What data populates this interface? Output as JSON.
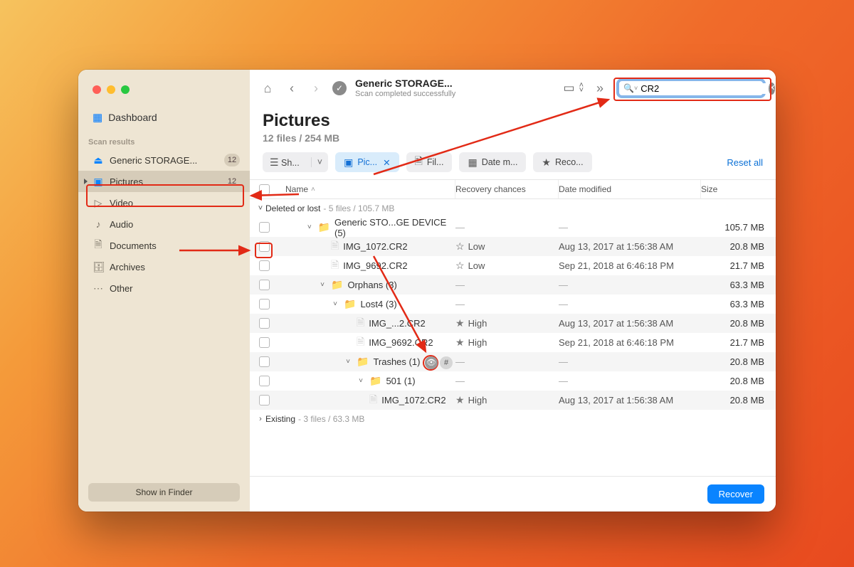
{
  "sidebar": {
    "dashboard": "Dashboard",
    "section": "Scan results",
    "items": [
      {
        "icon": "drive",
        "label": "Generic STORAGE...",
        "badge": "12"
      },
      {
        "icon": "image",
        "label": "Pictures",
        "badge": "12",
        "selected": true
      },
      {
        "icon": "video",
        "label": "Video"
      },
      {
        "icon": "audio",
        "label": "Audio"
      },
      {
        "icon": "doc",
        "label": "Documents"
      },
      {
        "icon": "arch",
        "label": "Archives"
      },
      {
        "icon": "other",
        "label": "Other"
      }
    ],
    "show_in_finder": "Show in Finder"
  },
  "toolbar": {
    "title": "Generic STORAGE...",
    "subtitle": "Scan completed successfully",
    "search_value": "CR2"
  },
  "heading": {
    "title": "Pictures",
    "subtitle": "12 files / 254 MB"
  },
  "filters": {
    "show": "Sh...",
    "pictures": "Pic...",
    "file": "Fil...",
    "date": "Date m...",
    "recovery": "Reco...",
    "reset": "Reset all"
  },
  "columns": {
    "name": "Name",
    "rc": "Recovery chances",
    "dm": "Date modified",
    "sz": "Size"
  },
  "sections": [
    {
      "label": "Deleted or lost",
      "meta": "5 files / 105.7 MB",
      "expanded": true
    },
    {
      "label": "Existing",
      "meta": "3 files / 63.3 MB",
      "expanded": false
    }
  ],
  "rows": [
    {
      "indent": 1,
      "type": "folder",
      "chev": "down",
      "name": "Generic STO...GE DEVICE (5)",
      "rc": "",
      "dm": "—",
      "size": "105.7 MB",
      "alt": false
    },
    {
      "indent": 2,
      "type": "file",
      "name": "IMG_1072.CR2",
      "rc": "Low",
      "rcFilled": false,
      "dm": "Aug 13, 2017 at 1:56:38 AM",
      "size": "20.8 MB",
      "alt": true
    },
    {
      "indent": 2,
      "type": "file",
      "name": "IMG_9692.CR2",
      "rc": "Low",
      "rcFilled": false,
      "dm": "Sep 21, 2018 at 6:46:18 PM",
      "size": "21.7 MB",
      "alt": false
    },
    {
      "indent": 2,
      "type": "folder",
      "chev": "down",
      "name": "Orphans (3)",
      "rc": "",
      "dm": "—",
      "size": "63.3 MB",
      "alt": true
    },
    {
      "indent": 3,
      "type": "folder",
      "chev": "down",
      "name": "Lost4 (3)",
      "rc": "",
      "dm": "—",
      "size": "63.3 MB",
      "alt": false
    },
    {
      "indent": 4,
      "type": "file",
      "name": "IMG_...2.CR2",
      "rc": "High",
      "rcFilled": true,
      "dm": "Aug 13, 2017 at 1:56:38 AM",
      "size": "20.8 MB",
      "alt": true,
      "preview": true
    },
    {
      "indent": 4,
      "type": "file",
      "name": "IMG_9692.CR2",
      "rc": "High",
      "rcFilled": true,
      "dm": "Sep 21, 2018 at 6:46:18 PM",
      "size": "21.7 MB",
      "alt": false
    },
    {
      "indent": 4,
      "type": "folder",
      "chev": "down",
      "name": "Trashes (1)",
      "rc": "",
      "dm": "—",
      "size": "20.8 MB",
      "alt": true
    },
    {
      "indent": 5,
      "type": "folder",
      "chev": "down",
      "name": "501 (1)",
      "rc": "",
      "dm": "—",
      "size": "20.8 MB",
      "alt": false
    },
    {
      "indent": 5,
      "type": "file",
      "name": "IMG_1072.CR2",
      "rc": "High",
      "rcFilled": true,
      "dm": "Aug 13, 2017 at 1:56:38 AM",
      "size": "20.8 MB",
      "alt": true
    }
  ],
  "footer": {
    "recover": "Recover"
  }
}
